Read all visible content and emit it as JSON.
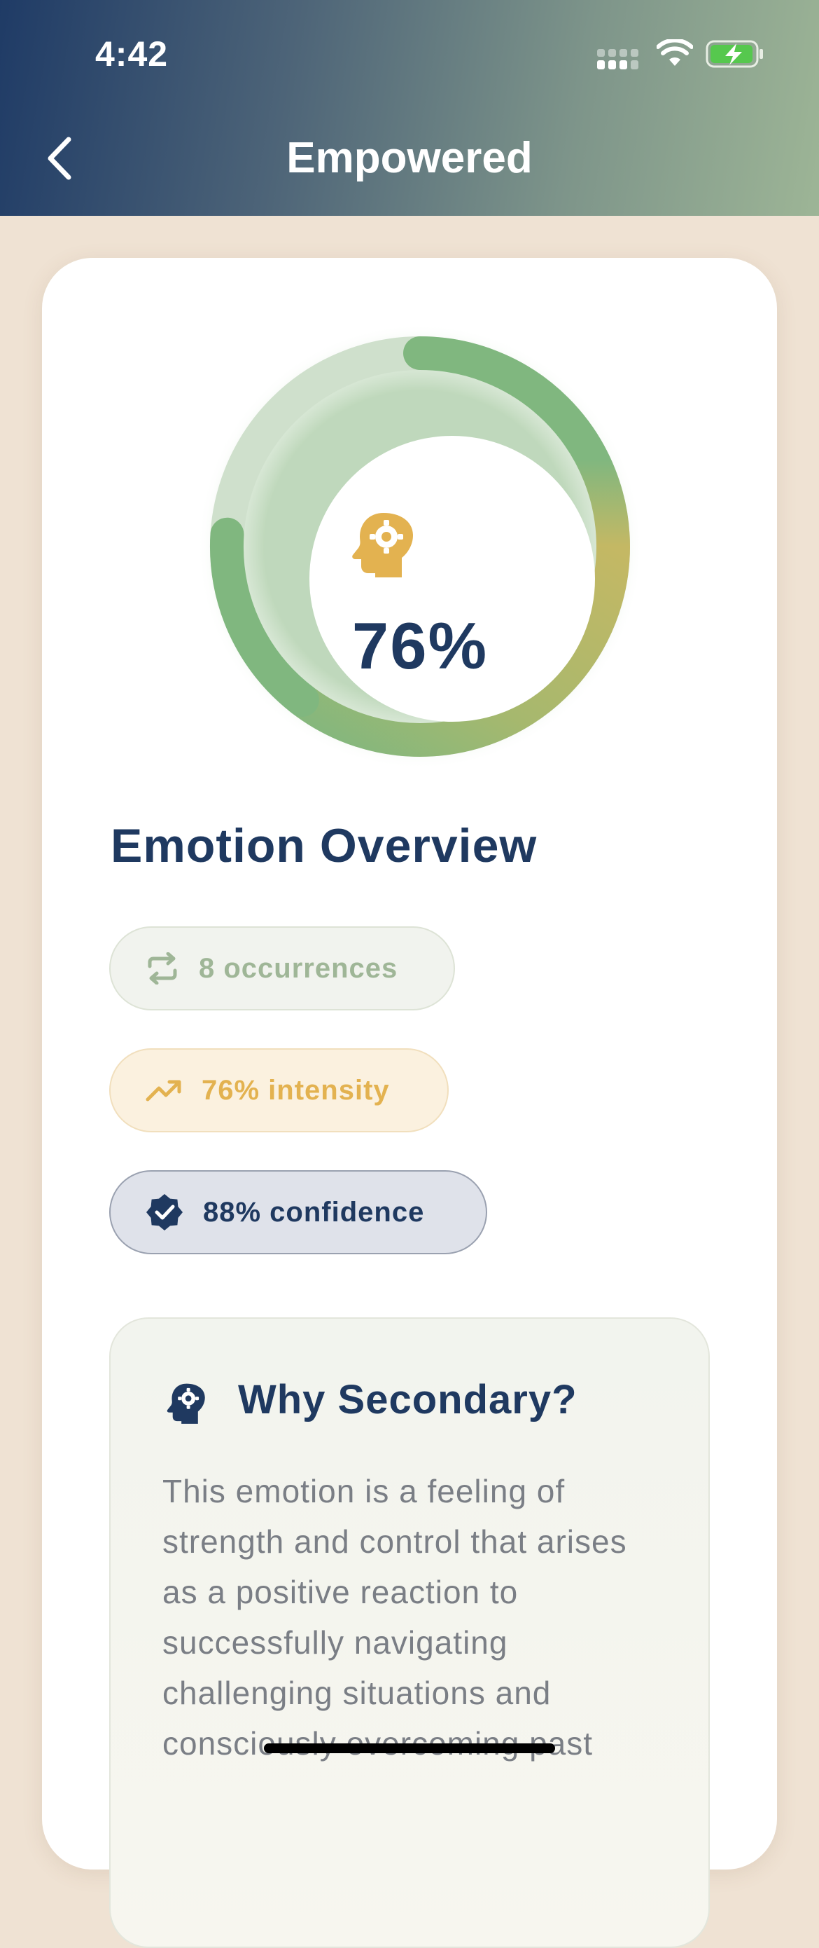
{
  "status_bar": {
    "time": "4:42",
    "icons": [
      "cellular-signal-icon",
      "wifi-icon",
      "battery-charging-icon"
    ]
  },
  "header": {
    "title": "Empowered",
    "back_icon": "chevron-left-icon"
  },
  "ring": {
    "value_label": "76%",
    "progress_fraction": 0.76,
    "center_icon": "head-gear-icon",
    "colors": {
      "green": "#80b77f",
      "yellow": "#c4b864",
      "track": "#cfe0cc"
    }
  },
  "overview": {
    "title": "Emotion Overview",
    "pills": {
      "occurrences": {
        "label": "8 occurrences",
        "icon": "repeat-icon"
      },
      "intensity": {
        "label": "76% intensity",
        "icon": "trending-up-icon"
      },
      "confidence": {
        "label": "88% confidence",
        "icon": "verified-badge-icon"
      }
    }
  },
  "why_card": {
    "title": "Why Secondary?",
    "icon": "head-gear-icon",
    "body": "This emotion is a feeling of strength and control that arises as a positive reaction to successfully navigating challenging situations and consciously overcoming past"
  },
  "colors": {
    "navy": "#1f3960",
    "accent_yellow": "#e3b250",
    "sage": "#9fb697",
    "background": "#efe2d3"
  }
}
